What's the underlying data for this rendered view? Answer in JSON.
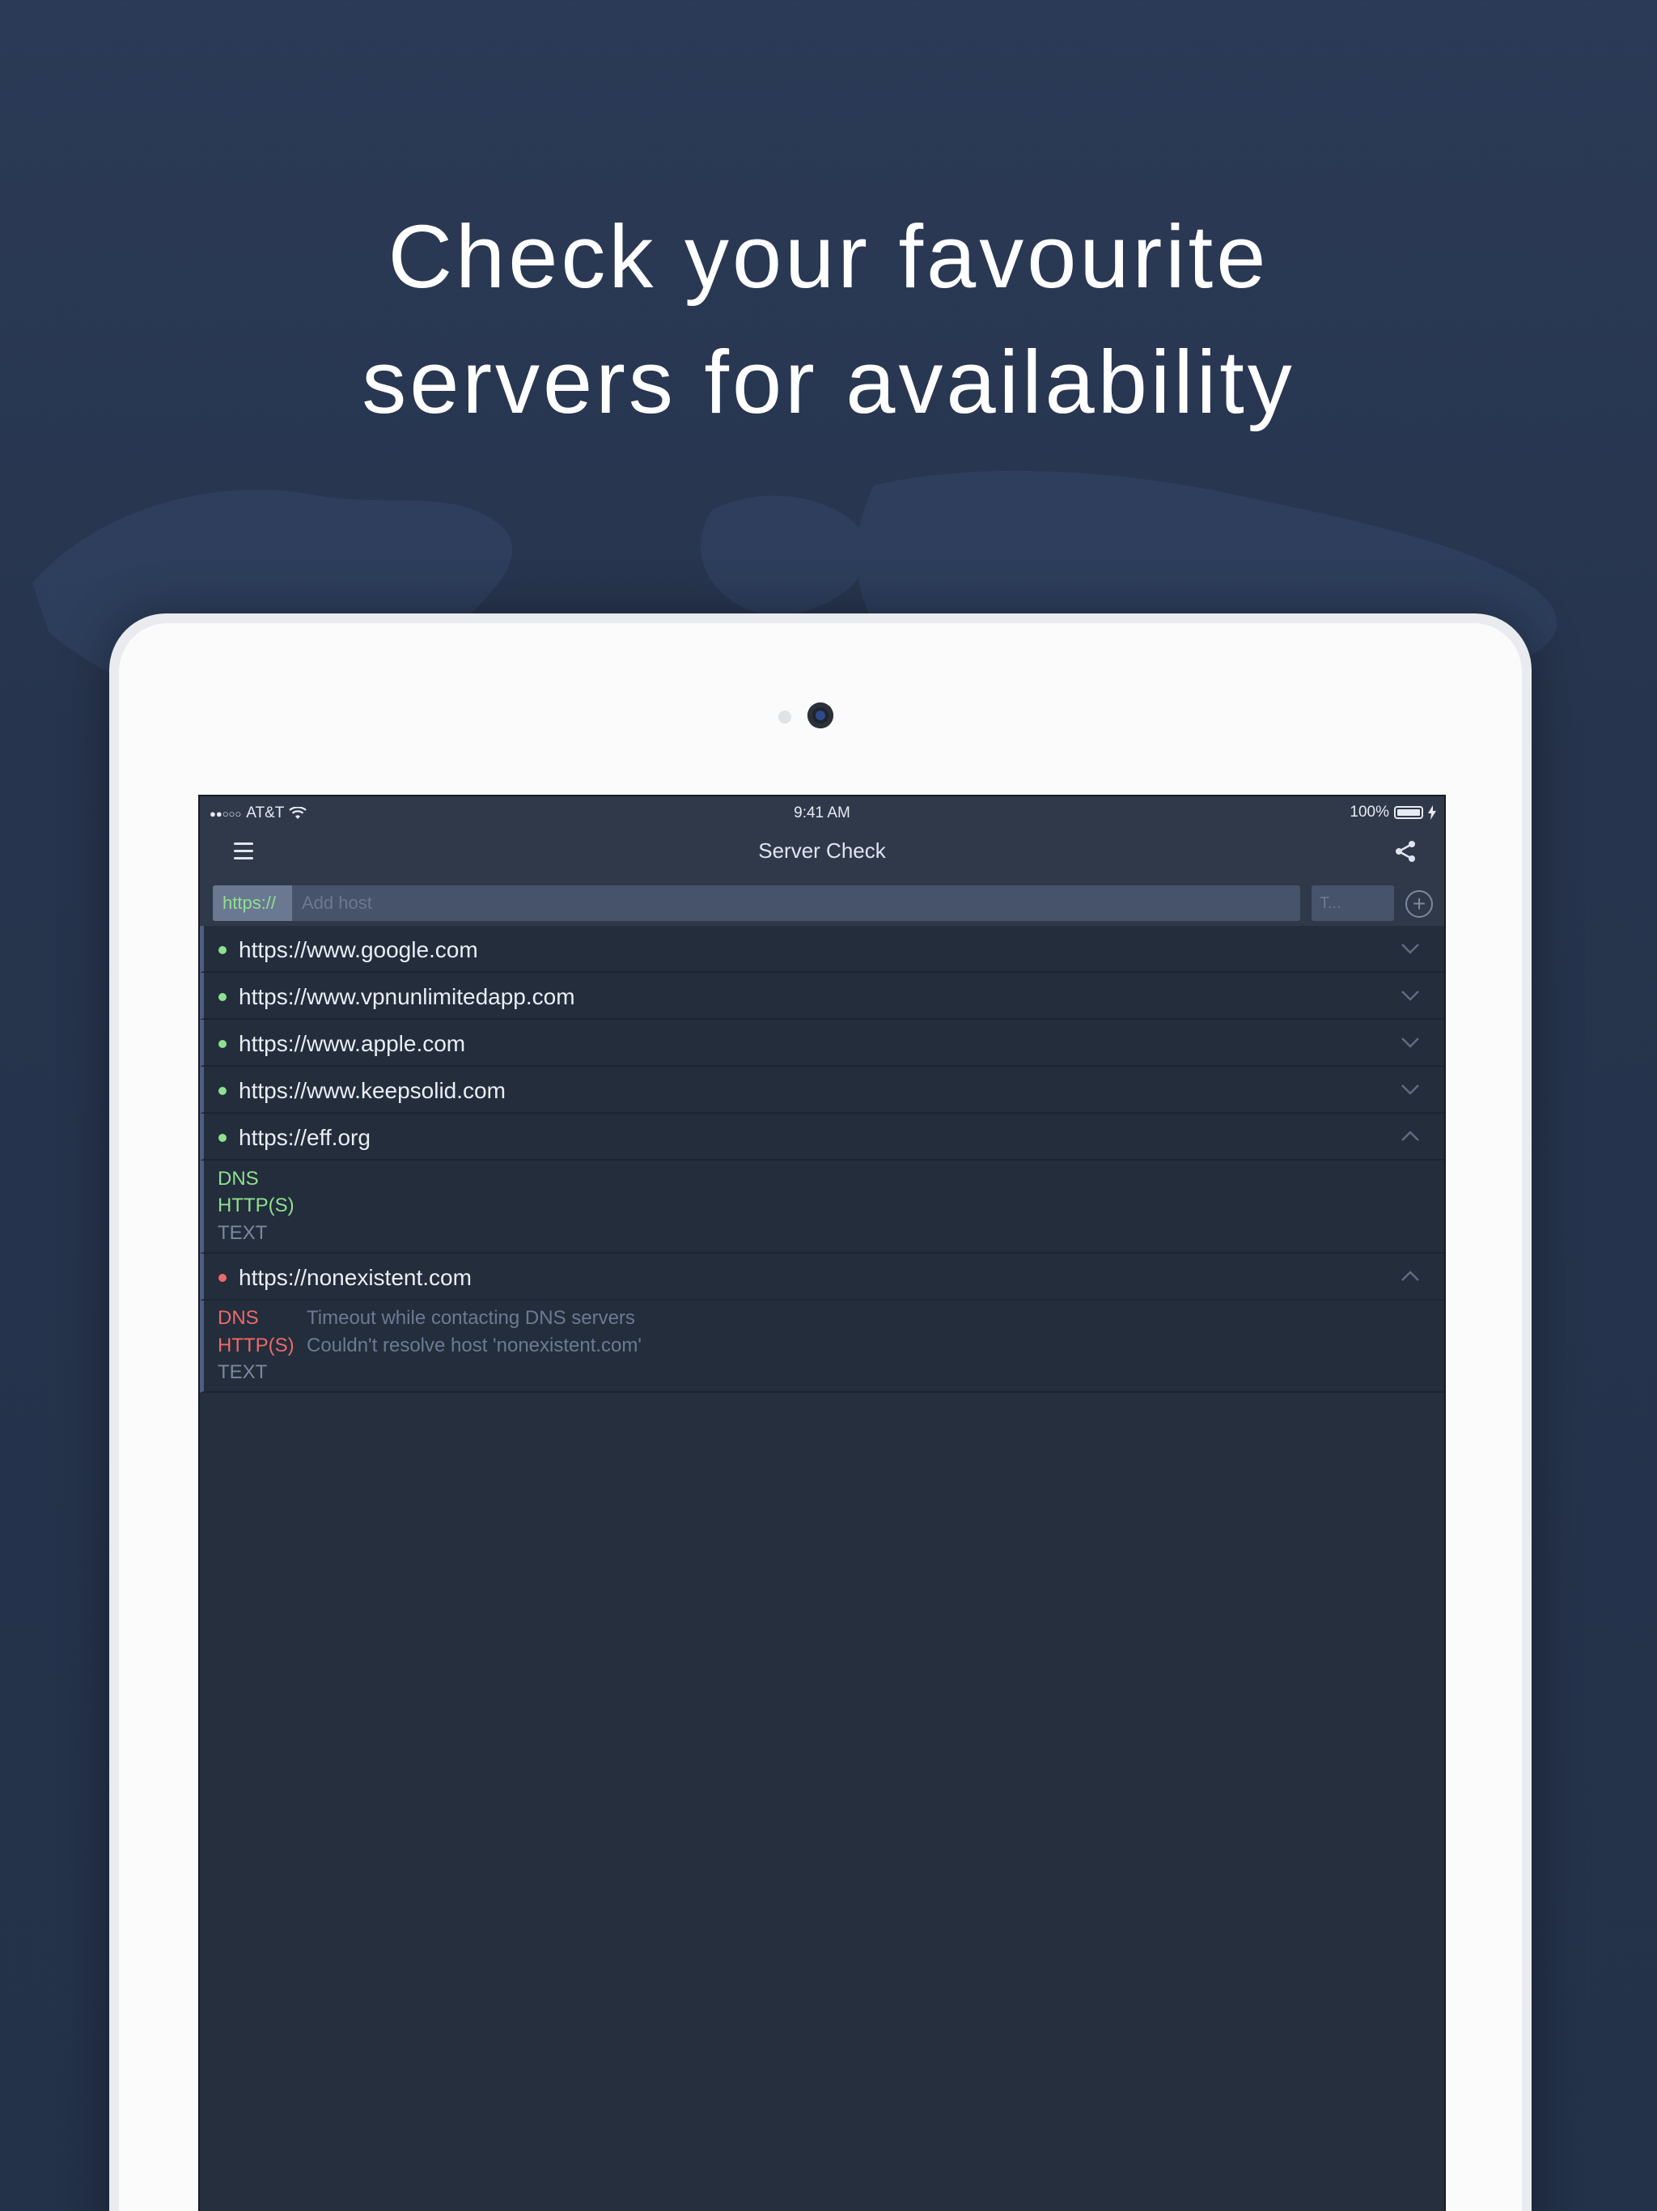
{
  "headline": {
    "line1": "Check your favourite",
    "line2": "servers for availability"
  },
  "statusbar": {
    "signal": "●●○○○",
    "carrier": "AT&T",
    "time": "9:41 AM",
    "battery": "100%"
  },
  "navbar": {
    "title": "Server Check"
  },
  "add_host": {
    "scheme": "https://",
    "host_placeholder": "Add host",
    "type_placeholder": "T..."
  },
  "hosts": [
    {
      "url": "https://www.google.com",
      "status": "up",
      "expanded": false
    },
    {
      "url": "https://www.vpnunlimitedapp.com",
      "status": "up",
      "expanded": false
    },
    {
      "url": "https://www.apple.com",
      "status": "up",
      "expanded": false
    },
    {
      "url": "https://www.keepsolid.com",
      "status": "up",
      "expanded": false
    },
    {
      "url": "https://eff.org",
      "status": "up",
      "expanded": true,
      "checks": [
        {
          "name": "DNS",
          "state": "ok",
          "message": ""
        },
        {
          "name": "HTTP(S)",
          "state": "ok",
          "message": ""
        },
        {
          "name": "TEXT",
          "state": "neutral",
          "message": ""
        }
      ]
    },
    {
      "url": "https://nonexistent.com",
      "status": "down",
      "expanded": true,
      "checks": [
        {
          "name": "DNS",
          "state": "fail",
          "message": "Timeout while contacting DNS servers"
        },
        {
          "name": "HTTP(S)",
          "state": "fail",
          "message": "Couldn't resolve host 'nonexistent.com'"
        },
        {
          "name": "TEXT",
          "state": "neutral",
          "message": ""
        }
      ]
    }
  ],
  "colors": {
    "up": "#8fe08f",
    "down": "#ec6a6a",
    "background": "#2b3a56",
    "screen": "#252f3e"
  },
  "icons": {
    "menu": "hamburger-menu-icon",
    "share": "share-icon",
    "add": "plus-circle-icon",
    "collapsed": "chevron-down-icon",
    "expanded": "chevron-up-icon",
    "wifi": "wifi-icon",
    "battery": "battery-icon"
  }
}
